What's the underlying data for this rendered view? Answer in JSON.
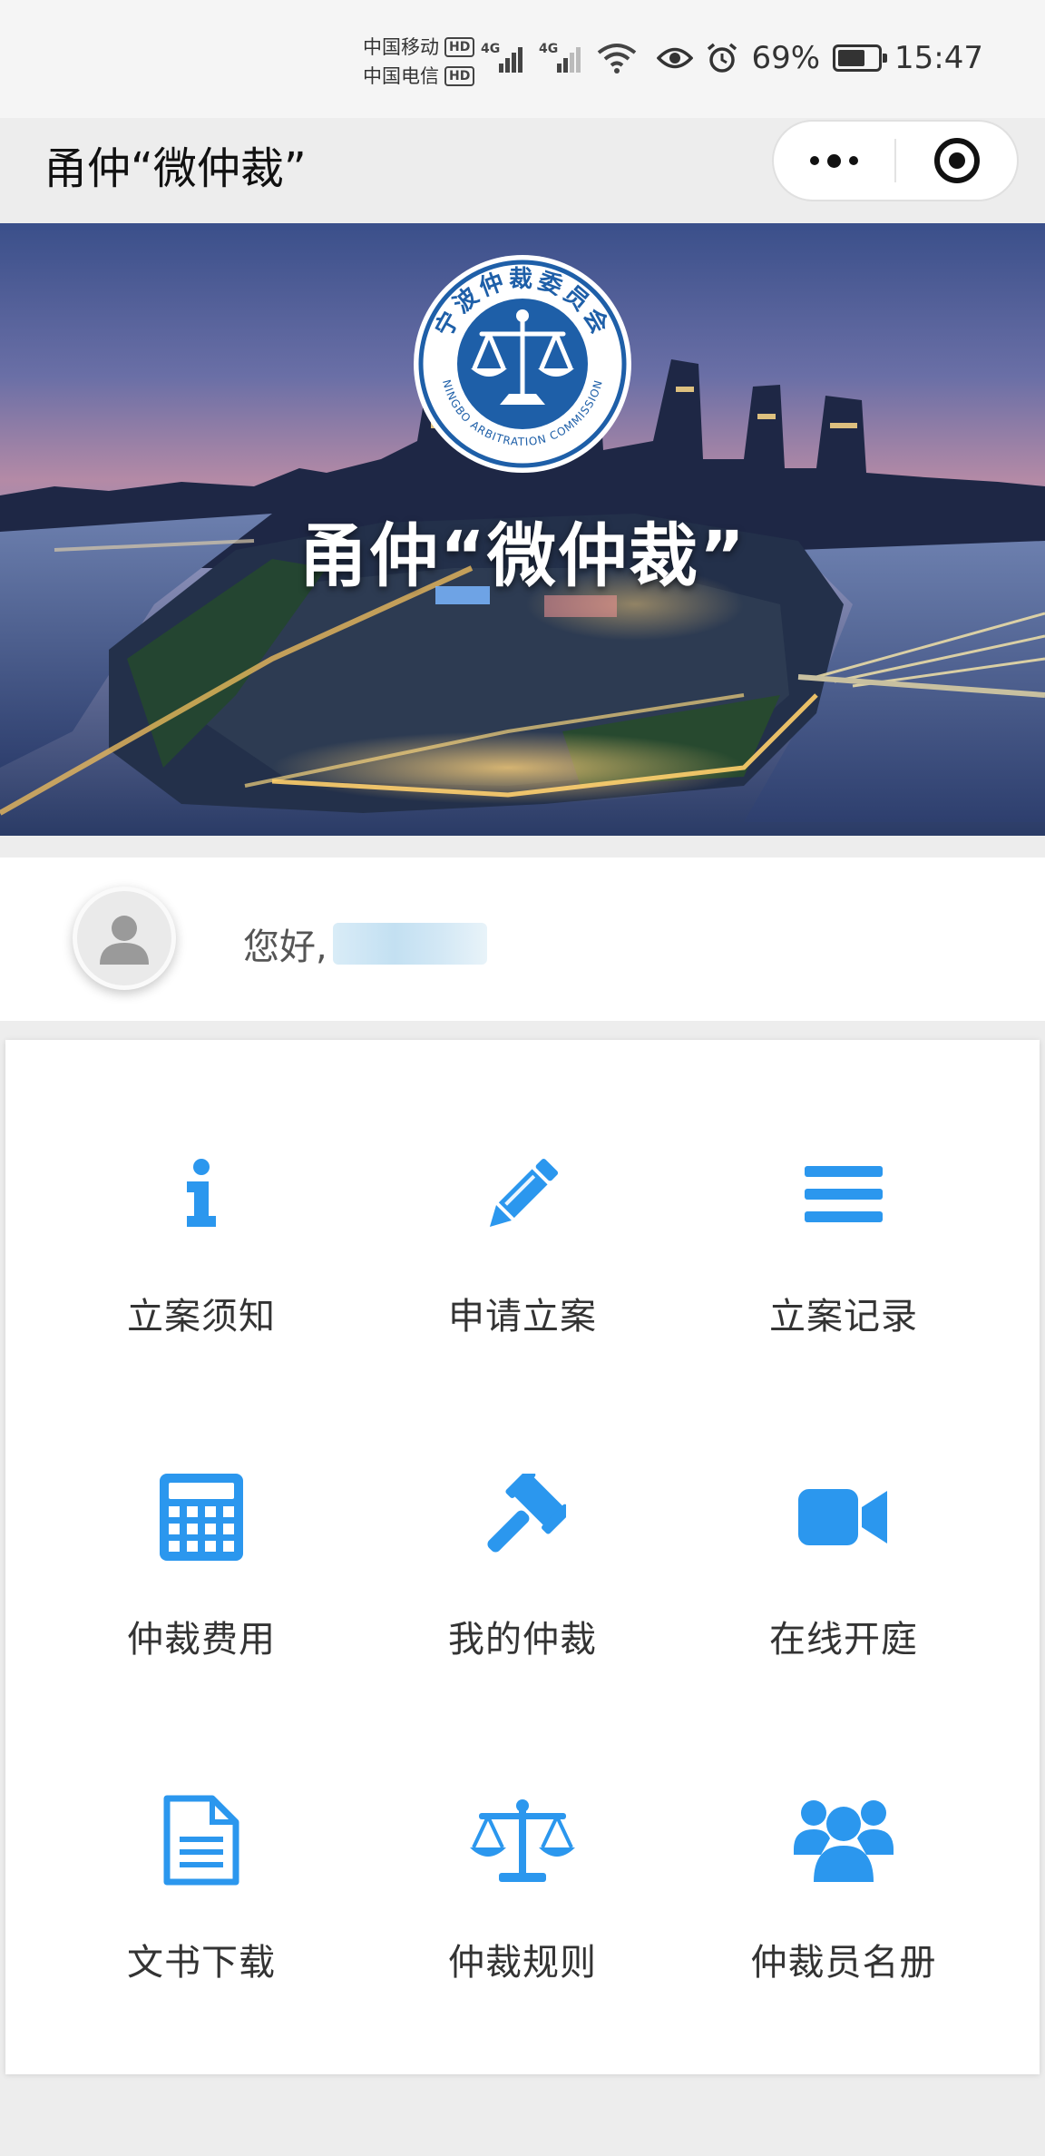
{
  "status_bar": {
    "carrier_1": "中国移动",
    "carrier_2": "中国电信",
    "hd_badge": "HD",
    "net_1": "4G",
    "net_2": "4G",
    "battery_percent": "69%",
    "battery_level": 0.69,
    "time": "15:47"
  },
  "nav": {
    "title": "甬仲“微仲裁”"
  },
  "banner": {
    "title": "甬仲“微仲裁”",
    "emblem_text": "宁波仲裁委员会",
    "emblem_subtext": "NINGBO ARBITRATION COMMISSION"
  },
  "user": {
    "greeting": "您好,"
  },
  "menu": {
    "items": [
      {
        "label": "立案须知",
        "icon": "info-icon"
      },
      {
        "label": "申请立案",
        "icon": "pencil-icon"
      },
      {
        "label": "立案记录",
        "icon": "list-icon"
      },
      {
        "label": "仲裁费用",
        "icon": "calculator-icon"
      },
      {
        "label": "我的仲裁",
        "icon": "gavel-icon"
      },
      {
        "label": "在线开庭",
        "icon": "video-camera-icon"
      },
      {
        "label": "文书下载",
        "icon": "document-icon"
      },
      {
        "label": "仲裁规则",
        "icon": "scales-icon"
      },
      {
        "label": "仲裁员名册",
        "icon": "users-icon"
      }
    ]
  },
  "colors": {
    "accent": "#2b97ee",
    "emblem_blue": "#1e5fa8"
  }
}
